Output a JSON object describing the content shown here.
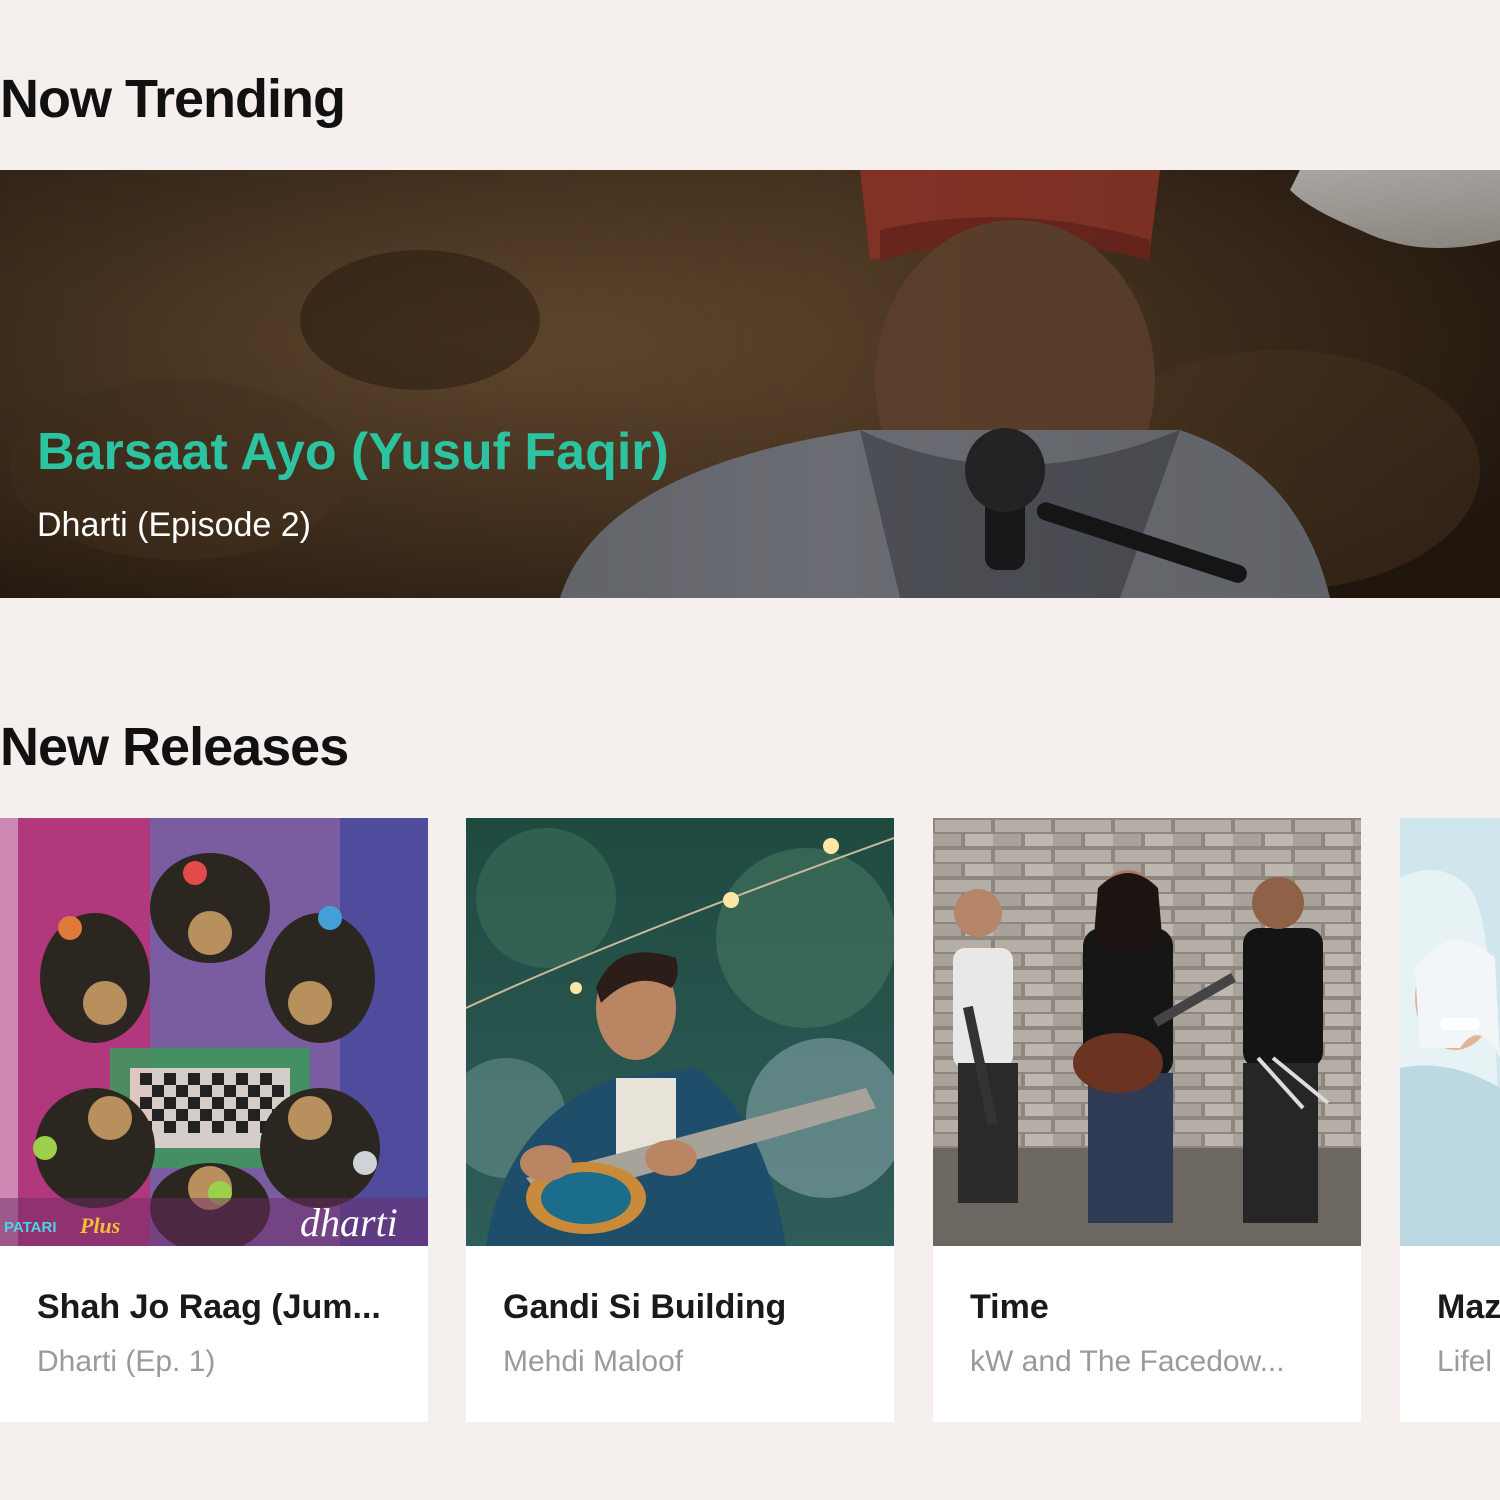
{
  "trending": {
    "heading": "Now Trending",
    "featured": {
      "title": "Barsaat Ayo (Yusuf Faqir)",
      "subtitle": "Dharti (Episode 2)"
    }
  },
  "new_releases": {
    "heading": "New Releases",
    "items": [
      {
        "title": "Shah Jo Raag (Jum...",
        "subtitle": "Dharti (Ep. 1)",
        "art_text": {
          "label": "PATARI",
          "brand": "Plus",
          "script": "dharti"
        }
      },
      {
        "title": "Gandi Si Building",
        "subtitle": "Mehdi Maloof"
      },
      {
        "title": "Time",
        "subtitle": "kW and The Facedow..."
      },
      {
        "title": "Maz",
        "subtitle": "Lifel"
      }
    ]
  },
  "colors": {
    "page_background": "#f5f0ee",
    "accent": "#2cc4a0",
    "heading": "#111111",
    "card_background": "#ffffff",
    "muted_text": "#9a9a9a"
  }
}
